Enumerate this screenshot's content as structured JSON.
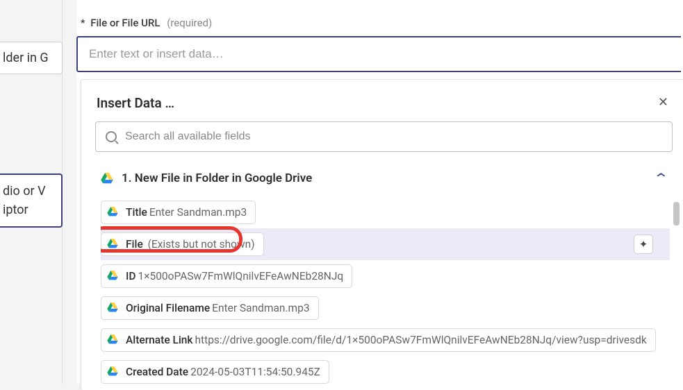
{
  "left_partial_top": "lder in G",
  "left_partial_mid_line1": "dio or V",
  "left_partial_mid_line2": "iptor",
  "field": {
    "star": "*",
    "label": "File or File URL",
    "hint": "(required)",
    "placeholder": "Enter text or insert data…"
  },
  "popover": {
    "title": "Insert Data …",
    "search_placeholder": "Search all available fields",
    "source": {
      "name": "1. New File in Folder in Google Drive"
    },
    "fields": [
      {
        "label": "Title",
        "value": "Enter Sandman.mp3"
      },
      {
        "label": "File",
        "value": "(Exists but not shown)",
        "selected": true
      },
      {
        "label": "ID",
        "value": "1×500oPASw7FmWlQnilvEFeAwNEb28NJq"
      },
      {
        "label": "Original Filename",
        "value": "Enter Sandman.mp3"
      },
      {
        "label": "Alternate Link",
        "value": "https://drive.google.com/file/d/1×500oPASw7FmWlQnilvEFeAwNEb28NJq/view?usp=drivesdk"
      },
      {
        "label": "Created Date",
        "value": "2024-05-03T11:54:50.945Z"
      }
    ]
  }
}
